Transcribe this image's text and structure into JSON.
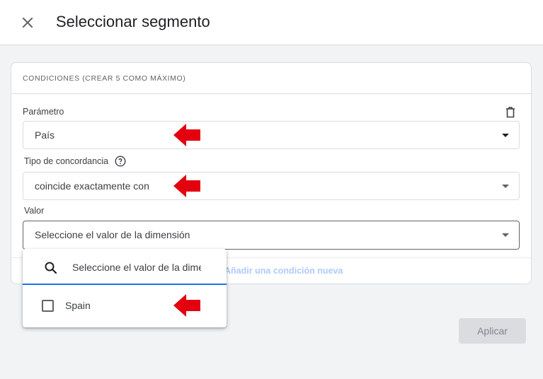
{
  "header": {
    "title": "Seleccionar segmento",
    "close_icon": "close-icon"
  },
  "conditions": {
    "header_label": "CONDICIONES (CREAR 5 COMO MÁXIMO)",
    "parameter": {
      "label": "Parámetro",
      "value": "País"
    },
    "match_type": {
      "label": "Tipo de concordancia",
      "value": "coincide exactamente con"
    },
    "value": {
      "label": "Valor",
      "value": "Seleccione el valor de la dimensión"
    },
    "add_condition_label": "Añadir una condición nueva",
    "delete_icon": "trash-icon"
  },
  "dropdown": {
    "search_placeholder": "Seleccione el valor de la dimensión",
    "options": [
      {
        "label": "Spain",
        "checked": false
      }
    ]
  },
  "footer": {
    "apply_label": "Aplicar"
  },
  "annotations": {
    "arrow_color": "#e3000f"
  },
  "colors": {
    "accent": "#1a73e8",
    "disabled_button": "#dadce0"
  }
}
